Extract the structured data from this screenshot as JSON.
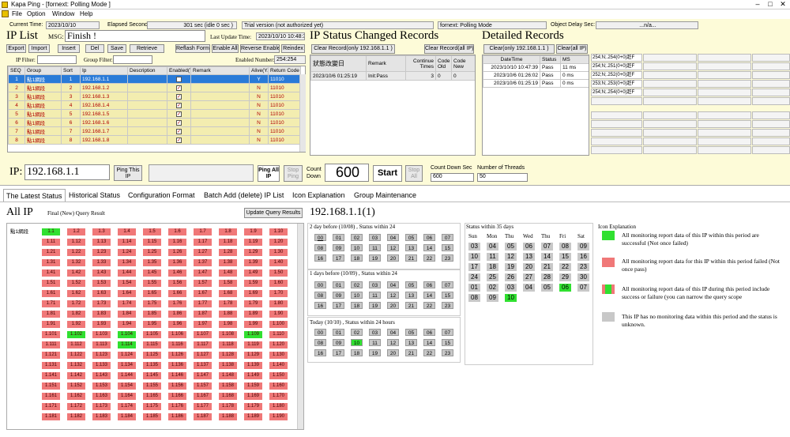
{
  "window": {
    "title": "Kapa Ping - [fornext: Polling Mode ]"
  },
  "menu": [
    "File",
    "Option",
    "Window",
    "Help"
  ],
  "status": {
    "current_time_label": "Current Time:",
    "current_time": "2023/10/10",
    "elapsed_label": "Elapsed Second",
    "elapsed": "301 sec (idle  0 sec )",
    "trial": "Trial version (not authorized yet)",
    "mode": "fornext: Polling Mode",
    "delay_label": "Object Delay Sec:",
    "delay": "...n/a..."
  },
  "iplist": {
    "title": "IP List",
    "msg_label": "MSG:",
    "msg": "Finish !",
    "last_update_label": "Last Update Time:",
    "last_update": "2023/10/10 10:48:39",
    "buttons": [
      "Export",
      "Import",
      "Insert",
      "Del",
      "Save",
      "Retrieve",
      "Reflash Form",
      "Enable All",
      "Reverse Enable",
      "Reindex"
    ],
    "ip_filter_label": "IP Filter:",
    "group_filter_label": "Group Filter:",
    "enabled_number_label": "Enabled Number:",
    "enabled_number": "254:254",
    "columns": [
      "SEQ",
      "Group",
      "Sort",
      "Ip",
      "Description",
      "Enabled(Y)",
      "Remark",
      "Alive(Y/N)",
      "Return Code"
    ],
    "rows": [
      {
        "seq": "1",
        "group": "點1網段",
        "sort": "1",
        "ip": "192.168.1.1",
        "alive": "Y",
        "code": "11010"
      },
      {
        "seq": "2",
        "group": "點1網段",
        "sort": "2",
        "ip": "192.168.1.2",
        "alive": "N",
        "code": "11010"
      },
      {
        "seq": "3",
        "group": "點1網段",
        "sort": "3",
        "ip": "192.168.1.3",
        "alive": "N",
        "code": "11010"
      },
      {
        "seq": "4",
        "group": "點1網段",
        "sort": "4",
        "ip": "192.168.1.4",
        "alive": "N",
        "code": "11010"
      },
      {
        "seq": "5",
        "group": "點1網段",
        "sort": "5",
        "ip": "192.168.1.5",
        "alive": "N",
        "code": "11010"
      },
      {
        "seq": "6",
        "group": "點1網段",
        "sort": "6",
        "ip": "192.168.1.6",
        "alive": "N",
        "code": "11010"
      },
      {
        "seq": "7",
        "group": "點1網段",
        "sort": "7",
        "ip": "192.168.1.7",
        "alive": "N",
        "code": "11010"
      },
      {
        "seq": "8",
        "group": "點1網段",
        "sort": "8",
        "ip": "192.168.1.8",
        "alive": "N",
        "code": "11010"
      }
    ]
  },
  "changed": {
    "title": "IP Status Changed Records",
    "btn_one": "Clear Record(only 192.168.1.1 )",
    "btn_all": "Clear Record(all IP)",
    "columns": [
      "狀態改變日",
      "Remark",
      "Continue Times",
      "Code Old",
      "Code New"
    ],
    "rows": [
      {
        "date": "2023/10/6 01:25:19",
        "remark": "Init:Pass",
        "times": "3",
        "old": "0",
        "new": "0"
      }
    ]
  },
  "detail": {
    "title": "Detailed Records",
    "btn_one": "Clear(only 192.168.1.1 )",
    "btn_all": "Clear(all IP)",
    "columns": [
      "DateTime",
      "Status",
      "MS"
    ],
    "rows": [
      {
        "dt": "2023/10/10 10:47:39",
        "st": "Pass",
        "ms": "11 ms"
      },
      {
        "dt": "2023/10/6 01:26:02",
        "st": "Pass",
        "ms": "0 ms"
      },
      {
        "dt": "2023/10/6 01:25:19",
        "st": "Pass",
        "ms": "0 ms"
      }
    ],
    "side": [
      "254;N;.254(0+0)赶F",
      "254;N;.251(0+0)赶F",
      "252;N;.252(0+0)赶F",
      "253;N;.253(0+0)赶F",
      "254;N;.254(0+0)赶F"
    ]
  },
  "ping": {
    "ip_label": "IP:",
    "ip": "192.168.1.1",
    "ping_this": "Ping This IP",
    "ping_all": "Ping All IP",
    "stop_ping": "Stop Ping",
    "countdown_label": "Count Down",
    "countdown": "600",
    "start": "Start",
    "stop_all": "Stop All",
    "cds_label": "Count Down Sec",
    "cds": "600",
    "threads_label": "Number of Threads",
    "threads": "50"
  },
  "tabs": [
    "The Latest Status",
    "Historical Status",
    "Configuration Format",
    "Batch Add (delete) IP List",
    "Icon Explanation",
    "Group Maintenance"
  ],
  "allip": {
    "title": "All IP",
    "subtitle": "Final (New) Query Result",
    "update_btn": "Update Query Results",
    "group": "點1網段"
  },
  "selected": {
    "title": "192.168.1.1(1)"
  },
  "hours": {
    "label_2d": "2 day before (10/08) , Status within 24",
    "label_1d": "1 days before (10/09) , Status within 24",
    "label_today": "Today (10/10) , Status within 24 hours",
    "values": [
      "00",
      "01",
      "02",
      "03",
      "04",
      "05",
      "06",
      "07",
      "08",
      "09",
      "10",
      "11",
      "12",
      "13",
      "14",
      "15",
      "16",
      "17",
      "18",
      "19",
      "20",
      "21",
      "22",
      "23"
    ]
  },
  "calendar": {
    "label": "Status within 35 days",
    "days": [
      "Sun",
      "Mon",
      "Thu",
      "Wed",
      "Thu",
      "Fri",
      "Sat"
    ],
    "dates": [
      "03",
      "04",
      "05",
      "06",
      "07",
      "08",
      "09",
      "10",
      "11",
      "12",
      "13",
      "14",
      "15",
      "16",
      "17",
      "18",
      "19",
      "20",
      "21",
      "22",
      "23",
      "24",
      "25",
      "26",
      "27",
      "28",
      "29",
      "30",
      "01",
      "02",
      "03",
      "04",
      "05",
      "06",
      "07",
      "08",
      "09",
      "10"
    ]
  },
  "legend": {
    "title": "Icon Explanation",
    "items": [
      {
        "color": "#30e030",
        "text": "All monitoring report data of this IP within this period are successful (Not once failed)"
      },
      {
        "color": "#f07878",
        "text": "All monitoring report data for this IP within this period failed (Not once pass)"
      },
      {
        "color": "mixed",
        "text": "All monitoring report data of this IP during this period include success or failure (you can narrow the query scope"
      },
      {
        "color": "#c8c8c8",
        "text": "This IP has no monitoring data within this period and the status is unknown."
      }
    ]
  }
}
